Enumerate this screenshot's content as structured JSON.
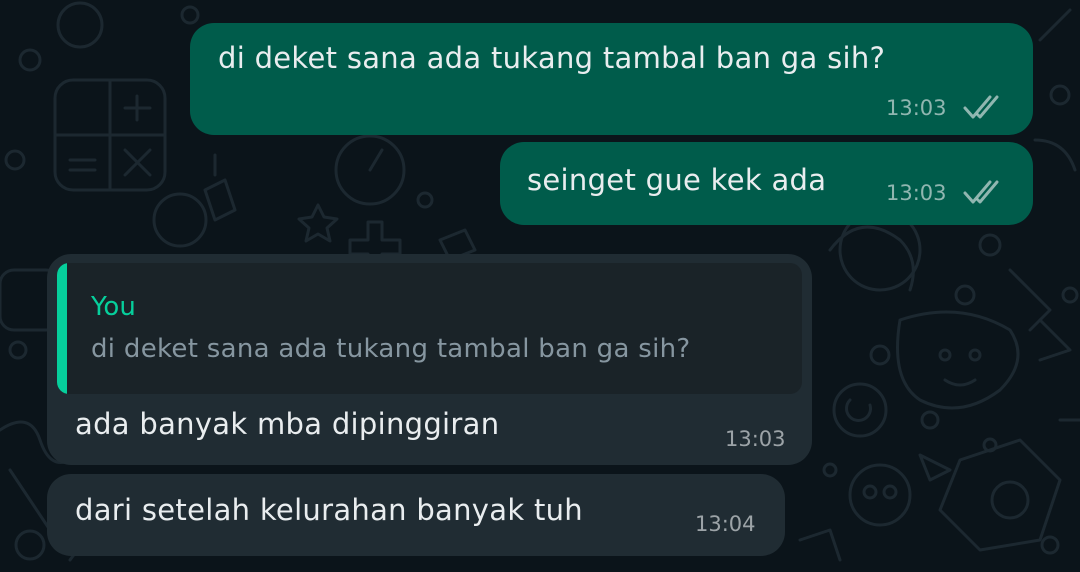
{
  "theme": {
    "background": "#0b141a",
    "outgoing_bubble": "#005c4b",
    "incoming_bubble": "#202c33",
    "quote_accent": "#06cf9c"
  },
  "messages": [
    {
      "direction": "outgoing",
      "text": "di deket sana ada tukang tambal ban ga sih?",
      "time": "13:03",
      "status_icon": "double-check-icon"
    },
    {
      "direction": "outgoing",
      "text": "seinget gue kek ada",
      "time": "13:03",
      "status_icon": "double-check-icon"
    },
    {
      "direction": "incoming",
      "quote": {
        "sender": "You",
        "text": "di deket sana ada tukang tambal ban ga sih?"
      },
      "text": "ada banyak mba dipinggiran",
      "time": "13:03"
    },
    {
      "direction": "incoming",
      "text": "dari setelah kelurahan banyak tuh",
      "time": "13:04"
    }
  ]
}
